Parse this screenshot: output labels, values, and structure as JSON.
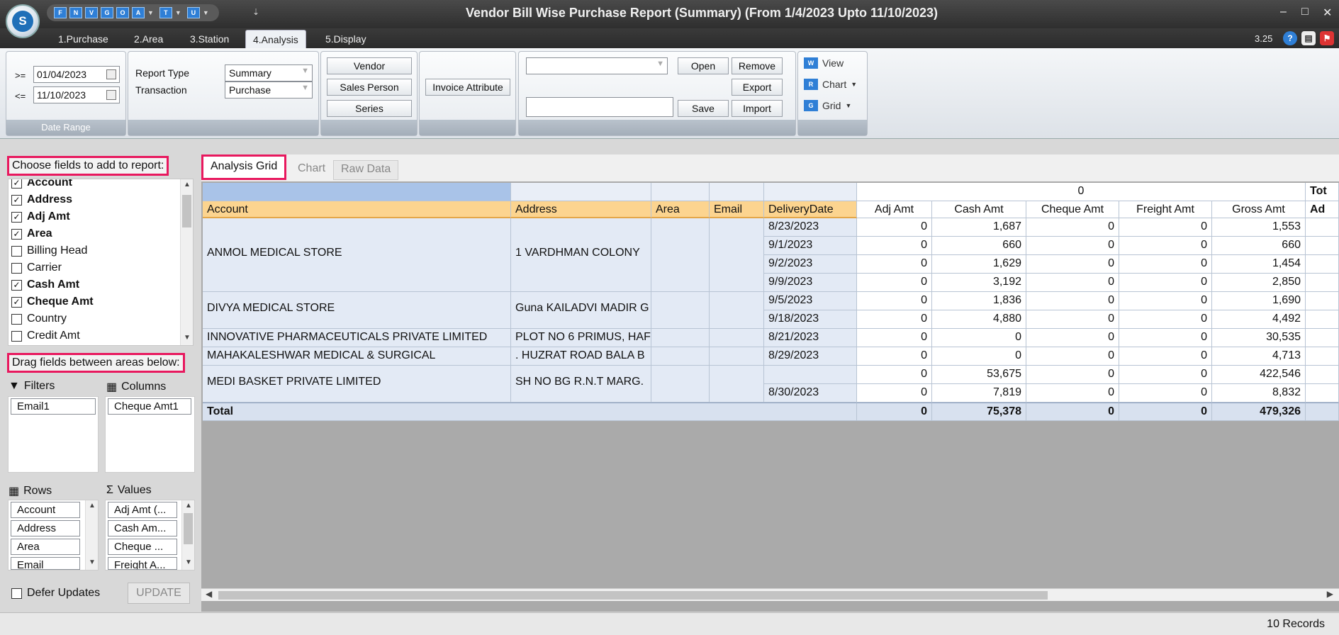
{
  "titlebar": {
    "logo_letter": "S",
    "title": "Vendor Bill Wise Purchase Report (Summary) (From 1/4/2023 Upto 11/10/2023)",
    "qat_buttons": [
      "F",
      "N",
      "V",
      "G",
      "O",
      "A",
      "T",
      "U"
    ],
    "minimize": "–",
    "maximize": "□",
    "close": "✕"
  },
  "tabs": [
    "1.Purchase",
    "2.Area",
    "3.Station",
    "4.Analysis",
    "5.Display"
  ],
  "version": "3.25",
  "ribbon": {
    "date_range": {
      "from_op": ">=",
      "from": "01/04/2023",
      "to_op": "<=",
      "to": "11/10/2023",
      "group_label": "Date Range"
    },
    "report_type_label": "Report Type",
    "report_type_value": "Summary",
    "transaction_label": "Transaction",
    "transaction_value": "Purchase",
    "buttons": {
      "vendor": "Vendor",
      "sales_person": "Sales Person",
      "series": "Series",
      "invoice_attribute": "Invoice Attribute",
      "open": "Open",
      "save": "Save",
      "remove": "Remove",
      "export": "Export",
      "import": "Import"
    },
    "view": {
      "view": "View",
      "chart": "Chart",
      "grid": "Grid"
    }
  },
  "left": {
    "choose_label": "Choose fields to add to report:",
    "fields": [
      {
        "name": "Account",
        "checked": true
      },
      {
        "name": "Address",
        "checked": true
      },
      {
        "name": "Adj Amt",
        "checked": true
      },
      {
        "name": "Area",
        "checked": true
      },
      {
        "name": "Billing Head",
        "checked": false
      },
      {
        "name": "Carrier",
        "checked": false
      },
      {
        "name": "Cash Amt",
        "checked": true
      },
      {
        "name": "Cheque Amt",
        "checked": true
      },
      {
        "name": "Country",
        "checked": false
      },
      {
        "name": "Credit Amt",
        "checked": false
      }
    ],
    "drag_label": "Drag fields between areas below:",
    "filters_title": "Filters",
    "filters": [
      "Email1"
    ],
    "columns_title": "Columns",
    "columns": [
      "Cheque Amt1"
    ],
    "rows_title": "Rows",
    "rows": [
      "Account",
      "Address",
      "Area",
      "Email"
    ],
    "values_title": "Values",
    "values": [
      "Adj Amt (...",
      "Cash Am...",
      "Cheque ...",
      "Freight A..."
    ],
    "defer_updates": "Defer Updates",
    "update": "UPDATE"
  },
  "grid": {
    "subtabs": [
      "Analysis Grid",
      "Chart",
      "Raw Data"
    ],
    "column_group": "0",
    "column_group_total": "Tot",
    "headers": [
      "Account",
      "Address",
      "Area",
      "Email",
      "DeliveryDate",
      "Adj Amt",
      "Cash Amt",
      "Cheque Amt",
      "Freight Amt",
      "Gross Amt",
      "Ad"
    ],
    "rows": [
      {
        "date": "8/23/2023",
        "adj": "0",
        "cash": "1,687",
        "cheque": "0",
        "freight": "0",
        "gross": "1,553"
      },
      {
        "date": "9/1/2023",
        "adj": "0",
        "cash": "660",
        "cheque": "0",
        "freight": "0",
        "gross": "660"
      },
      {
        "date": "9/2/2023",
        "adj": "0",
        "cash": "1,629",
        "cheque": "0",
        "freight": "0",
        "gross": "1,454"
      },
      {
        "date": "9/9/2023",
        "adj": "0",
        "cash": "3,192",
        "cheque": "0",
        "freight": "0",
        "gross": "2,850"
      },
      {
        "date": "9/5/2023",
        "adj": "0",
        "cash": "1,836",
        "cheque": "0",
        "freight": "0",
        "gross": "1,690"
      },
      {
        "date": "9/18/2023",
        "adj": "0",
        "cash": "4,880",
        "cheque": "0",
        "freight": "0",
        "gross": "4,492"
      },
      {
        "date": "8/21/2023",
        "adj": "0",
        "cash": "0",
        "cheque": "0",
        "freight": "0",
        "gross": "30,535"
      },
      {
        "date": "8/29/2023",
        "adj": "0",
        "cash": "0",
        "cheque": "0",
        "freight": "0",
        "gross": "4,713"
      },
      {
        "date": "",
        "adj": "0",
        "cash": "53,675",
        "cheque": "0",
        "freight": "0",
        "gross": "422,546"
      },
      {
        "date": "8/30/2023",
        "adj": "0",
        "cash": "7,819",
        "cheque": "0",
        "freight": "0",
        "gross": "8,832"
      }
    ],
    "groups": [
      {
        "account": "ANMOL MEDICAL STORE",
        "address": "1  VARDHMAN COLONY"
      },
      {
        "account": "DIVYA MEDICAL STORE",
        "address": "Guna  KAILADVI MADIR G"
      },
      {
        "account": "INNOVATIVE PHARMACEUTICALS PRIVATE LIMITED",
        "address": "PLOT NO 6 PRIMUS, HAF"
      },
      {
        "account": "MAHAKALESHWAR MEDICAL & SURGICAL",
        "address": ". HUZRAT ROAD BALA B"
      },
      {
        "account": "MEDI BASKET PRIVATE LIMITED",
        "address": "SH NO BG R.N.T MARG."
      }
    ],
    "total": {
      "label": "Total",
      "adj": "0",
      "cash": "75,378",
      "cheque": "0",
      "freight": "0",
      "gross": "479,326"
    }
  },
  "status": {
    "records": "10 Records"
  }
}
